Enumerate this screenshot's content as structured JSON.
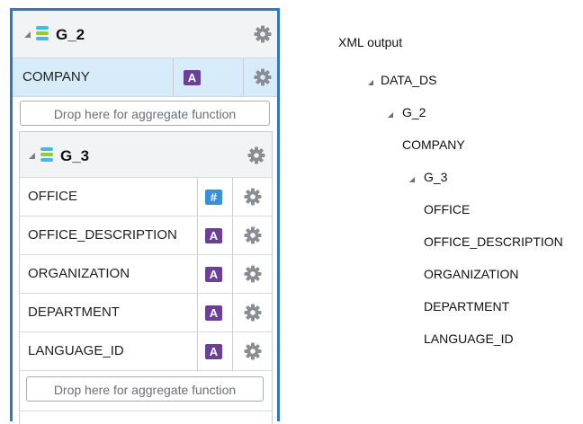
{
  "left_panel": {
    "group_g2": {
      "title": "G_2"
    },
    "company_row": {
      "label": "COMPANY",
      "type_badge": "A",
      "type_icon": "alpha-type-icon"
    },
    "drop_g2": "Drop here for aggregate function",
    "group_g3": {
      "title": "G_3",
      "rows": [
        {
          "label": "OFFICE",
          "badge": "#",
          "badge_kind": "numeric"
        },
        {
          "label": "OFFICE_DESCRIPTION",
          "badge": "A",
          "badge_kind": "alpha"
        },
        {
          "label": "ORGANIZATION",
          "badge": "A",
          "badge_kind": "alpha"
        },
        {
          "label": "DEPARTMENT",
          "badge": "A",
          "badge_kind": "alpha"
        },
        {
          "label": "LANGUAGE_ID",
          "badge": "A",
          "badge_kind": "alpha"
        }
      ],
      "drop": "Drop here for aggregate function"
    }
  },
  "xml_output": {
    "title": "XML output",
    "root": "DATA_DS",
    "g2": "G_2",
    "company": "COMPANY",
    "g3": "G_3",
    "leaves": [
      "OFFICE",
      "OFFICE_DESCRIPTION",
      "ORGANIZATION",
      "DEPARTMENT",
      "LANGUAGE_ID"
    ]
  },
  "colors": {
    "panel_border": "#2e77c8",
    "selected_row": "#d6ecfa",
    "alpha_badge": "#6c3f99",
    "numeric_badge": "#3a8fd9"
  }
}
